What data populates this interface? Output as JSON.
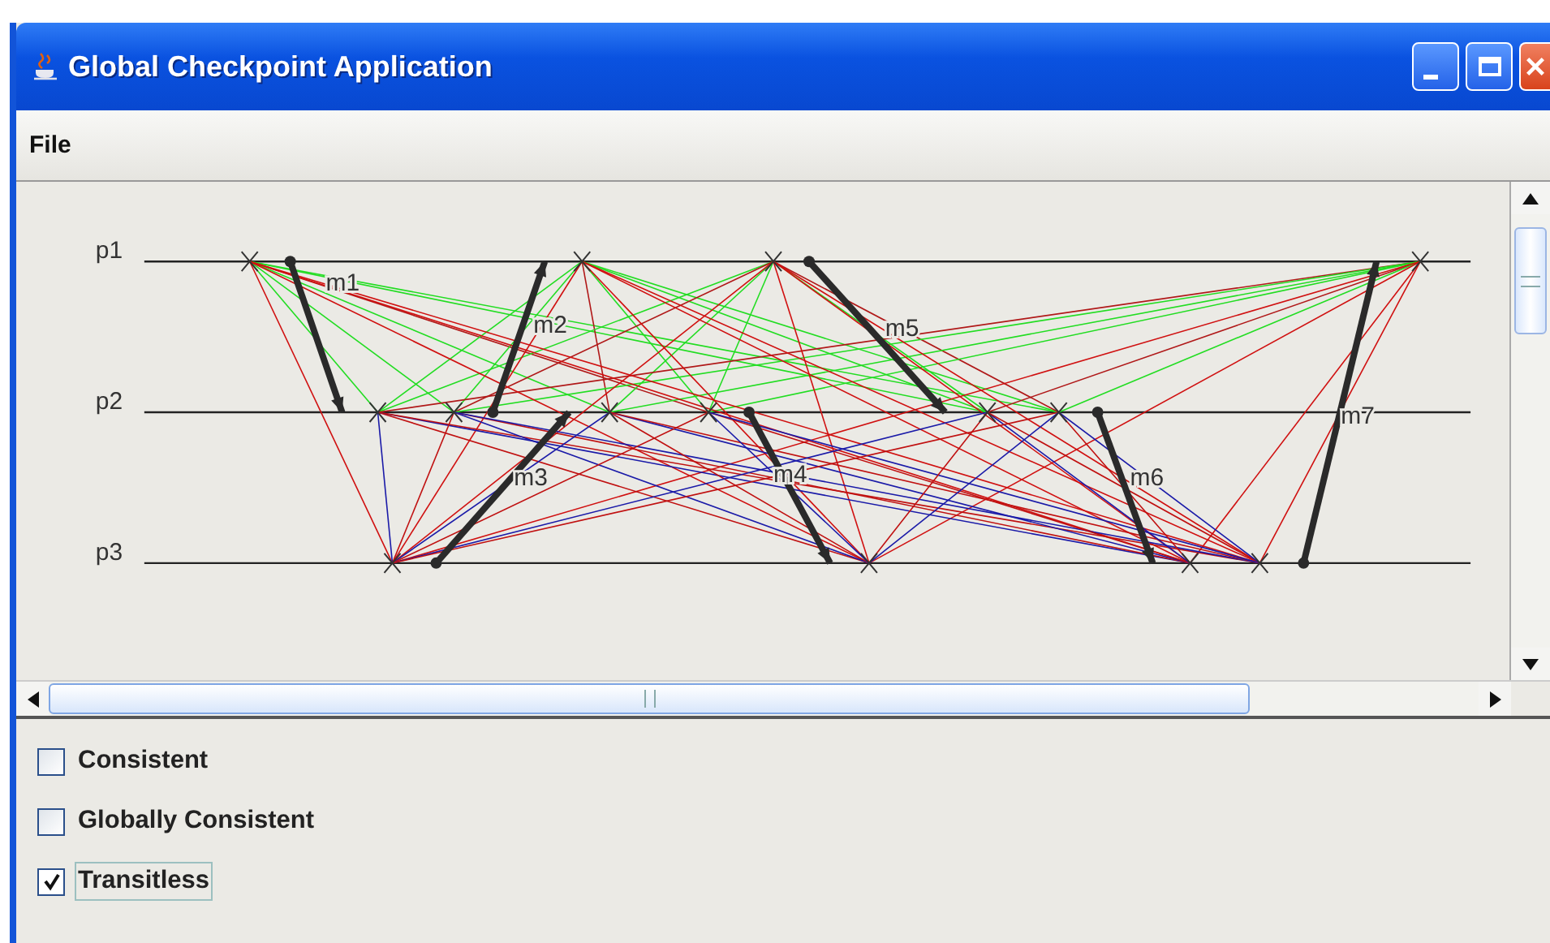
{
  "window": {
    "title": "Global Checkpoint Application"
  },
  "menu": [
    {
      "label": "File"
    }
  ],
  "diagram": {
    "processes": [
      {
        "label": "p1"
      },
      {
        "label": "p2"
      },
      {
        "label": "p3"
      }
    ],
    "messages": [
      {
        "label": "m1"
      },
      {
        "label": "m2"
      },
      {
        "label": "m3"
      },
      {
        "label": "m4"
      },
      {
        "label": "m5"
      },
      {
        "label": "m6"
      },
      {
        "label": "m7"
      }
    ]
  },
  "checkboxes": [
    {
      "label": "Consistent",
      "checked": false,
      "focused": false
    },
    {
      "label": "Globally Consistent",
      "checked": false,
      "focused": false
    },
    {
      "label": "Transitless",
      "checked": true,
      "focused": true
    }
  ]
}
